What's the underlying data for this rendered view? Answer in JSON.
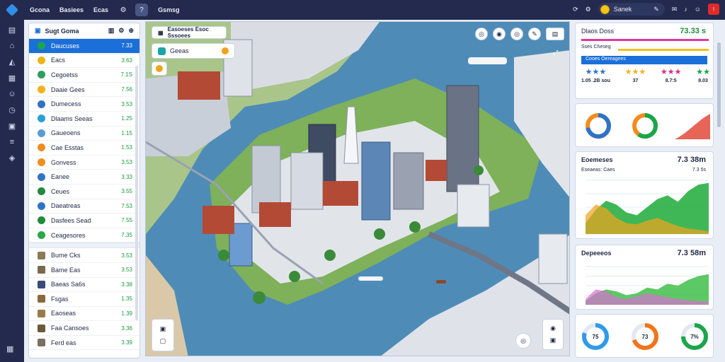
{
  "topbar": {
    "menu": [
      "Gcona",
      "Basiees",
      "Ecas"
    ],
    "search_text": "Gsmsg",
    "coin_label": "Sanek"
  },
  "left_panel": {
    "title": "Sugt Goma",
    "list_a": [
      {
        "label": "Daucuses",
        "value": "7.33",
        "color": "#1aa64a"
      },
      {
        "label": "Eacs",
        "value": "3.63",
        "color": "#f2b21b"
      },
      {
        "label": "Cegoetss",
        "value": "7.1S",
        "color": "#2f9d5b"
      },
      {
        "label": "Daaie Gees",
        "value": "7.56",
        "color": "#f2b21b"
      },
      {
        "label": "Dumecess",
        "value": "3.53",
        "color": "#2f73c9"
      },
      {
        "label": "Dlaams Seeas",
        "value": "1.25",
        "color": "#2aa0d8"
      },
      {
        "label": "Gaueoens",
        "value": "1.15",
        "color": "#5b9bd5"
      },
      {
        "label": "Cae Esstas",
        "value": "1.53",
        "color": "#f28c1b"
      },
      {
        "label": "Gonvess",
        "value": "3.53",
        "color": "#f28c1b"
      },
      {
        "label": "Eanee",
        "value": "3.33",
        "color": "#2f73c9"
      },
      {
        "label": "Ceues",
        "value": "3.55",
        "color": "#1f8a3a"
      },
      {
        "label": "Daeatreas",
        "value": "7.53",
        "color": "#2f73c9"
      },
      {
        "label": "Dasfees Sead",
        "value": "7.55",
        "color": "#1f8a3a"
      },
      {
        "label": "Ceagesores",
        "value": "7.35",
        "color": "#2aa84a"
      }
    ],
    "list_b": [
      {
        "label": "Bume Cks",
        "value": "3.53",
        "color": "#8a7a5a"
      },
      {
        "label": "Bame Eas",
        "value": "3.53",
        "color": "#7a6a4a"
      },
      {
        "label": "Baeas Sa6s",
        "value": "3.38",
        "color": "#3a4a7a"
      },
      {
        "label": "Fsgas",
        "value": "1.35",
        "color": "#8a6a3a"
      },
      {
        "label": "Eaoseas",
        "value": "1.39",
        "color": "#9a7a4a"
      },
      {
        "label": "Faa Cansoes",
        "value": "3.36",
        "color": "#6a5a3a"
      },
      {
        "label": "Ferd eas",
        "value": "3.39",
        "color": "#7a7060"
      }
    ]
  },
  "map": {
    "title": "Easoeses Esoc Sssoees",
    "layer_label": "Geeas",
    "controls": [
      "◎",
      "◉",
      "◎",
      "✎",
      "▤"
    ]
  },
  "right_panel": {
    "summary": {
      "title": "Dlaos Doss",
      "value": "73.33 s",
      "bar_label": "Sses Cheseg",
      "highlight": "Cooes Oereagees"
    },
    "ratings": [
      {
        "label": "1.05 .2B sou",
        "stars": "★★★",
        "colors": "#2f73c9"
      },
      {
        "label": "37",
        "stars": "★★★",
        "colors": "#f2b21b"
      },
      {
        "label": "8.7:5",
        "stars": "★★★",
        "colors": "#d12f8a"
      },
      {
        "label": "8.03",
        "stars": "★★",
        "colors": "#1aa64a"
      }
    ],
    "donuts": [
      {
        "name": "donut-a",
        "fraction": 0.72,
        "colors": [
          "#2f73c9",
          "#f28c1b"
        ]
      },
      {
        "name": "donut-b",
        "fraction": 0.6,
        "colors": [
          "#1aa64a",
          "#f28c1b"
        ]
      }
    ],
    "card2": {
      "title": "Eoemeses",
      "value": "7.3 38m",
      "subtitle": "Eseaeas: Caes",
      "sub_value": "7.3 5s"
    },
    "card3": {
      "title": "Depeeeos",
      "value": "7.3 58m"
    },
    "rings": [
      {
        "label": "75",
        "fraction": 0.8,
        "color": "#2f9be8"
      },
      {
        "label": "73",
        "fraction": 0.7,
        "color": "#f2741b"
      },
      {
        "label": "7%",
        "fraction": 0.75,
        "color": "#1aa64a"
      }
    ]
  },
  "chart_data": [
    {
      "type": "area",
      "x": [
        0,
        1,
        2,
        3,
        4,
        5,
        6,
        7,
        8,
        9,
        10,
        11,
        12
      ],
      "series": [
        {
          "values": [
            20,
            45,
            62,
            55,
            40,
            35,
            50,
            65,
            72,
            60,
            80,
            92,
            95
          ],
          "color": "#1faa3a"
        },
        {
          "values": [
            35,
            55,
            48,
            30,
            20,
            18,
            25,
            30,
            22,
            15,
            10,
            8,
            5
          ],
          "color": "#f2a21b"
        }
      ],
      "ylim": [
        0,
        100
      ]
    },
    {
      "type": "area",
      "x": [
        0,
        1,
        2,
        3,
        4,
        5,
        6,
        7,
        8,
        9,
        10,
        11,
        12
      ],
      "series": [
        {
          "values": [
            10,
            30,
            40,
            35,
            25,
            30,
            45,
            40,
            55,
            50,
            65,
            75,
            80
          ],
          "color": "#3fbf4a"
        },
        {
          "values": [
            15,
            40,
            35,
            20,
            15,
            22,
            30,
            25,
            20,
            15,
            12,
            10,
            8
          ],
          "color": "#d96fd1"
        }
      ],
      "ylim": [
        0,
        100
      ]
    }
  ]
}
